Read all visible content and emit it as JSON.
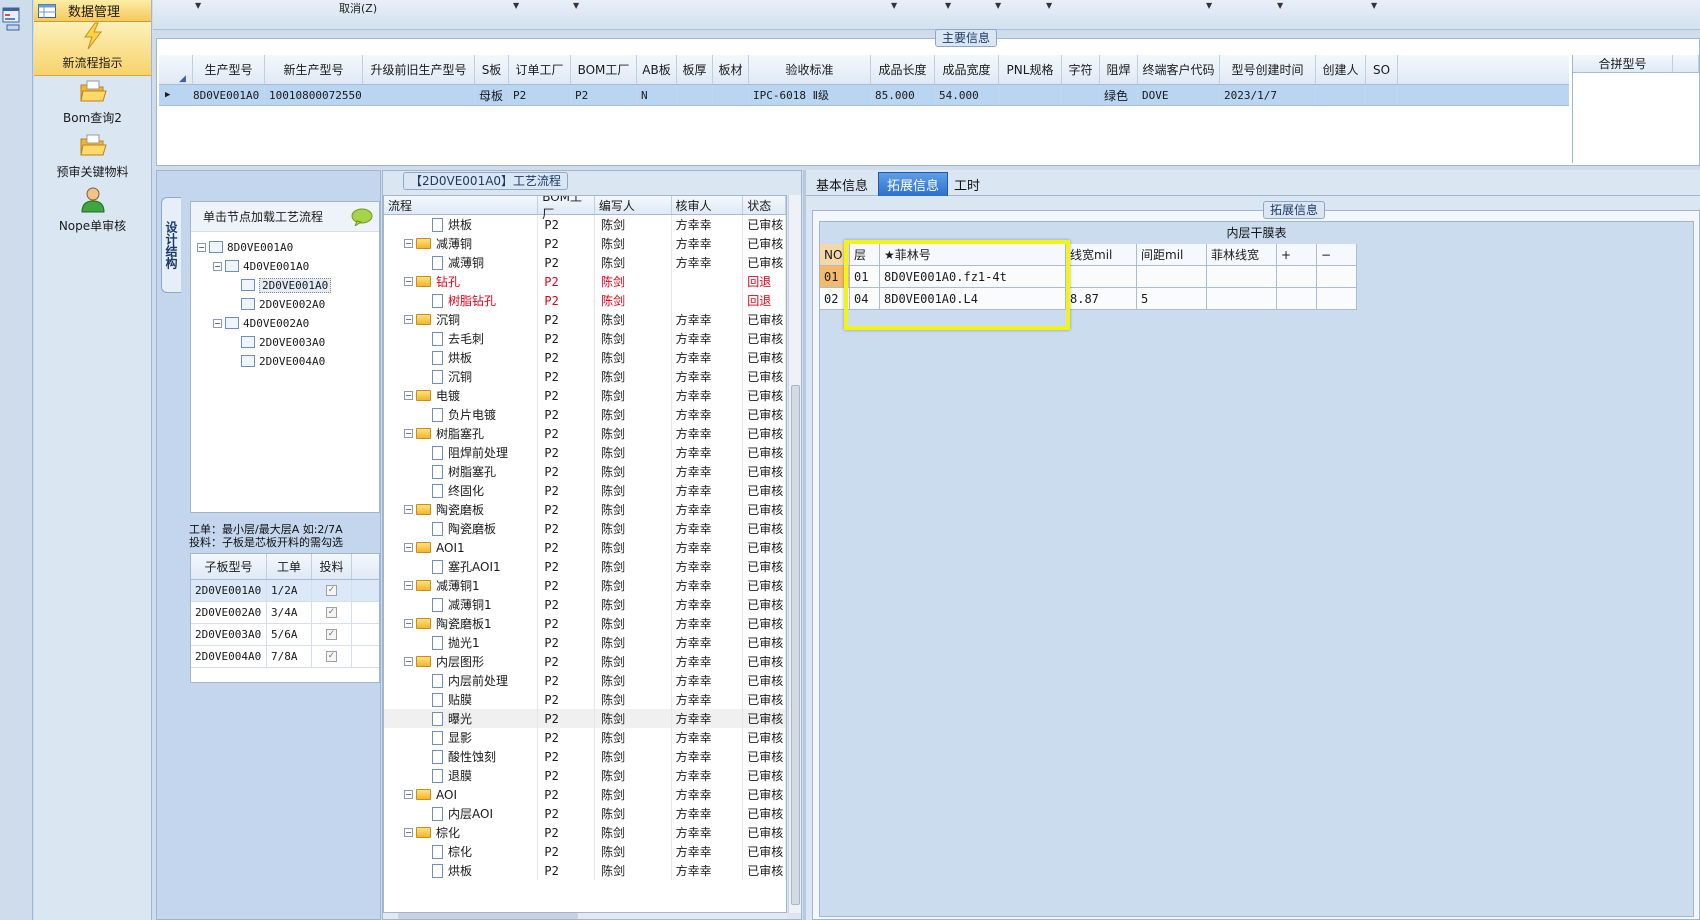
{
  "nav": {
    "header_label": "数据管理",
    "items": [
      {
        "label": "新流程指示",
        "icon": "lightning-icon",
        "active": true
      },
      {
        "label": "Bom查询2",
        "icon": "folder-open-icon",
        "active": false
      },
      {
        "label": "预审关键物料",
        "icon": "folder-open-icon",
        "active": false
      },
      {
        "label": "Nope单审核",
        "icon": "user-icon",
        "active": false
      }
    ]
  },
  "toolbar": {
    "cancel_label": "取消(Z)"
  },
  "main_info": {
    "title": "主要信息",
    "columns": [
      "生产型号",
      "新生产型号",
      "升级前旧生产型号",
      "S板",
      "订单工厂",
      "BOM工厂",
      "AB板",
      "板厚",
      "板材",
      "验收标准",
      "成品长度",
      "成品宽度",
      "PNL规格",
      "字符",
      "阻焊",
      "终端客户代码",
      "型号创建时间",
      "创建人",
      "SO"
    ],
    "row": [
      "8D0VE001A0",
      "10010800072550",
      "",
      "母板",
      "P2",
      "P2",
      "N",
      "",
      "",
      "IPC-6018 Ⅱ级",
      "85.000",
      "54.000",
      "",
      "",
      "绿色",
      "DOVE",
      "2023/1/7",
      "",
      ""
    ],
    "merge_header": "合拼型号"
  },
  "tree_panel": {
    "vertical_tab": "设计结构",
    "header": "单击节点加载工艺流程",
    "nodes": [
      "8D0VE001A0",
      "4D0VE001A0",
      "2D0VE001A0",
      "2D0VE002A0",
      "4D0VE002A0",
      "2D0VE003A0",
      "2D0VE004A0"
    ],
    "note_line1": "工单：最小层/最大层A 如:2/7A",
    "note_line2": "投料：子板是芯板开料的需勾选",
    "sub_columns": [
      "子板型号",
      "工单",
      "投料"
    ],
    "sub_rows": [
      {
        "model": "2D0VE001A0",
        "order": "1/2A",
        "checked": true
      },
      {
        "model": "2D0VE002A0",
        "order": "3/4A",
        "checked": true
      },
      {
        "model": "2D0VE003A0",
        "order": "5/6A",
        "checked": true
      },
      {
        "model": "2D0VE004A0",
        "order": "7/8A",
        "checked": true
      }
    ]
  },
  "flow_panel": {
    "title": "【2D0VE001A0】工艺流程",
    "columns": [
      "流程",
      "BOM工厂",
      "编写人",
      "核审人",
      "状态"
    ],
    "rows": [
      {
        "name": "烘板",
        "level": 2,
        "bom": "P2",
        "writer": "陈剑",
        "reviewer": "方幸幸",
        "status": "已审核"
      },
      {
        "name": "减薄铜",
        "level": 1,
        "bom": "P2",
        "writer": "陈剑",
        "reviewer": "方幸幸",
        "status": "已审核"
      },
      {
        "name": "减薄铜",
        "level": 2,
        "bom": "P2",
        "writer": "陈剑",
        "reviewer": "方幸幸",
        "status": "已审核"
      },
      {
        "name": "钻孔",
        "level": 1,
        "bom": "P2",
        "writer": "陈剑",
        "reviewer": "",
        "status": "回退",
        "red": true
      },
      {
        "name": "树脂钻孔",
        "level": 2,
        "bom": "P2",
        "writer": "陈剑",
        "reviewer": "",
        "status": "回退",
        "red": true
      },
      {
        "name": "沉铜",
        "level": 1,
        "bom": "P2",
        "writer": "陈剑",
        "reviewer": "方幸幸",
        "status": "已审核"
      },
      {
        "name": "去毛刺",
        "level": 2,
        "bom": "P2",
        "writer": "陈剑",
        "reviewer": "方幸幸",
        "status": "已审核"
      },
      {
        "name": "烘板",
        "level": 2,
        "bom": "P2",
        "writer": "陈剑",
        "reviewer": "方幸幸",
        "status": "已审核"
      },
      {
        "name": "沉铜",
        "level": 2,
        "bom": "P2",
        "writer": "陈剑",
        "reviewer": "方幸幸",
        "status": "已审核"
      },
      {
        "name": "电镀",
        "level": 1,
        "bom": "P2",
        "writer": "陈剑",
        "reviewer": "方幸幸",
        "status": "已审核"
      },
      {
        "name": "负片电镀",
        "level": 2,
        "bom": "P2",
        "writer": "陈剑",
        "reviewer": "方幸幸",
        "status": "已审核"
      },
      {
        "name": "树脂塞孔",
        "level": 1,
        "bom": "P2",
        "writer": "陈剑",
        "reviewer": "方幸幸",
        "status": "已审核"
      },
      {
        "name": "阻焊前处理",
        "level": 2,
        "bom": "P2",
        "writer": "陈剑",
        "reviewer": "方幸幸",
        "status": "已审核"
      },
      {
        "name": "树脂塞孔",
        "level": 2,
        "bom": "P2",
        "writer": "陈剑",
        "reviewer": "方幸幸",
        "status": "已审核"
      },
      {
        "name": "终固化",
        "level": 2,
        "bom": "P2",
        "writer": "陈剑",
        "reviewer": "方幸幸",
        "status": "已审核"
      },
      {
        "name": "陶瓷磨板",
        "level": 1,
        "bom": "P2",
        "writer": "陈剑",
        "reviewer": "方幸幸",
        "status": "已审核"
      },
      {
        "name": "陶瓷磨板",
        "level": 2,
        "bom": "P2",
        "writer": "陈剑",
        "reviewer": "方幸幸",
        "status": "已审核"
      },
      {
        "name": "AOI1",
        "level": 1,
        "bom": "P2",
        "writer": "陈剑",
        "reviewer": "方幸幸",
        "status": "已审核"
      },
      {
        "name": "塞孔AOI1",
        "level": 2,
        "bom": "P2",
        "writer": "陈剑",
        "reviewer": "方幸幸",
        "status": "已审核"
      },
      {
        "name": "减薄铜1",
        "level": 1,
        "bom": "P2",
        "writer": "陈剑",
        "reviewer": "方幸幸",
        "status": "已审核"
      },
      {
        "name": "减薄铜1",
        "level": 2,
        "bom": "P2",
        "writer": "陈剑",
        "reviewer": "方幸幸",
        "status": "已审核"
      },
      {
        "name": "陶瓷磨板1",
        "level": 1,
        "bom": "P2",
        "writer": "陈剑",
        "reviewer": "方幸幸",
        "status": "已审核"
      },
      {
        "name": "抛光1",
        "level": 2,
        "bom": "P2",
        "writer": "陈剑",
        "reviewer": "方幸幸",
        "status": "已审核"
      },
      {
        "name": "内层图形",
        "level": 1,
        "bom": "P2",
        "writer": "陈剑",
        "reviewer": "方幸幸",
        "status": "已审核"
      },
      {
        "name": "内层前处理",
        "level": 2,
        "bom": "P2",
        "writer": "陈剑",
        "reviewer": "方幸幸",
        "status": "已审核"
      },
      {
        "name": "贴膜",
        "level": 2,
        "bom": "P2",
        "writer": "陈剑",
        "reviewer": "方幸幸",
        "status": "已审核"
      },
      {
        "name": "曝光",
        "level": 2,
        "bom": "P2",
        "writer": "陈剑",
        "reviewer": "方幸幸",
        "status": "已审核",
        "selected": true
      },
      {
        "name": "显影",
        "level": 2,
        "bom": "P2",
        "writer": "陈剑",
        "reviewer": "方幸幸",
        "status": "已审核"
      },
      {
        "name": "酸性蚀刻",
        "level": 2,
        "bom": "P2",
        "writer": "陈剑",
        "reviewer": "方幸幸",
        "status": "已审核"
      },
      {
        "name": "退膜",
        "level": 2,
        "bom": "P2",
        "writer": "陈剑",
        "reviewer": "方幸幸",
        "status": "已审核"
      },
      {
        "name": "AOI",
        "level": 1,
        "bom": "P2",
        "writer": "陈剑",
        "reviewer": "方幸幸",
        "status": "已审核"
      },
      {
        "name": "内层AOI",
        "level": 2,
        "bom": "P2",
        "writer": "陈剑",
        "reviewer": "方幸幸",
        "status": "已审核"
      },
      {
        "name": "棕化",
        "level": 1,
        "bom": "P2",
        "writer": "陈剑",
        "reviewer": "方幸幸",
        "status": "已审核"
      },
      {
        "name": "棕化",
        "level": 2,
        "bom": "P2",
        "writer": "陈剑",
        "reviewer": "方幸幸",
        "status": "已审核"
      },
      {
        "name": "烘板",
        "level": 2,
        "bom": "P2",
        "writer": "陈剑",
        "reviewer": "方幸幸",
        "status": "已审核"
      }
    ]
  },
  "right_tabs": {
    "tabs": [
      "基本信息",
      "拓展信息",
      "工时"
    ],
    "active_index": 1
  },
  "ext_info": {
    "title": "拓展信息",
    "table_title": "内层干膜表",
    "columns": [
      "NO",
      "层",
      "★菲林号",
      "线宽mil",
      "间距mil",
      "菲林线宽",
      "+",
      "−"
    ],
    "rows": [
      {
        "no": "01",
        "layer": "01",
        "film": "8D0VE001A0.fz1-4t",
        "width": "",
        "spacing": "",
        "film_width": ""
      },
      {
        "no": "02",
        "layer": "04",
        "film": "8D0VE001A0.L4",
        "width": "8.87",
        "spacing": "5",
        "film_width": ""
      }
    ]
  },
  "colors": {
    "accent_tab": "#2c6fcf",
    "selected_row": "#b9d5f2",
    "highlight_box": "#f3f31c",
    "rollback_text": "#e0001a"
  }
}
